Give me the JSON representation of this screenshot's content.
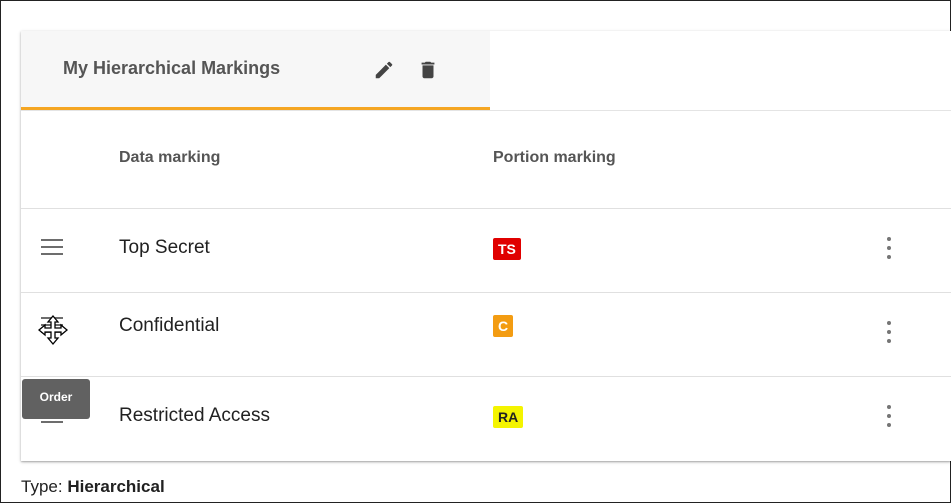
{
  "tab": {
    "title": "My Hierarchical Markings",
    "edit_icon": "pencil-icon",
    "delete_icon": "trash-icon"
  },
  "table": {
    "columns": [
      "Data marking",
      "Portion marking"
    ],
    "rows": [
      {
        "label": "Top Secret",
        "badge": "TS",
        "badge_bg": "#e00000",
        "badge_fg": "#ffffff"
      },
      {
        "label": "Confidential",
        "badge": "C",
        "badge_bg": "#f39c12",
        "badge_fg": "#ffffff"
      },
      {
        "label": "Restricted Access",
        "badge": "RA",
        "badge_bg": "#f4f400",
        "badge_fg": "#222222"
      }
    ]
  },
  "tooltip": {
    "text": "Order"
  },
  "footer": {
    "type_label": "Type:",
    "type_value": "Hierarchical"
  },
  "colors": {
    "accent": "#f5a623"
  },
  "icons": {
    "drag_handle": "drag-handle-icon",
    "more": "more-vert-icon",
    "move_cursor": "move-cursor-icon"
  }
}
